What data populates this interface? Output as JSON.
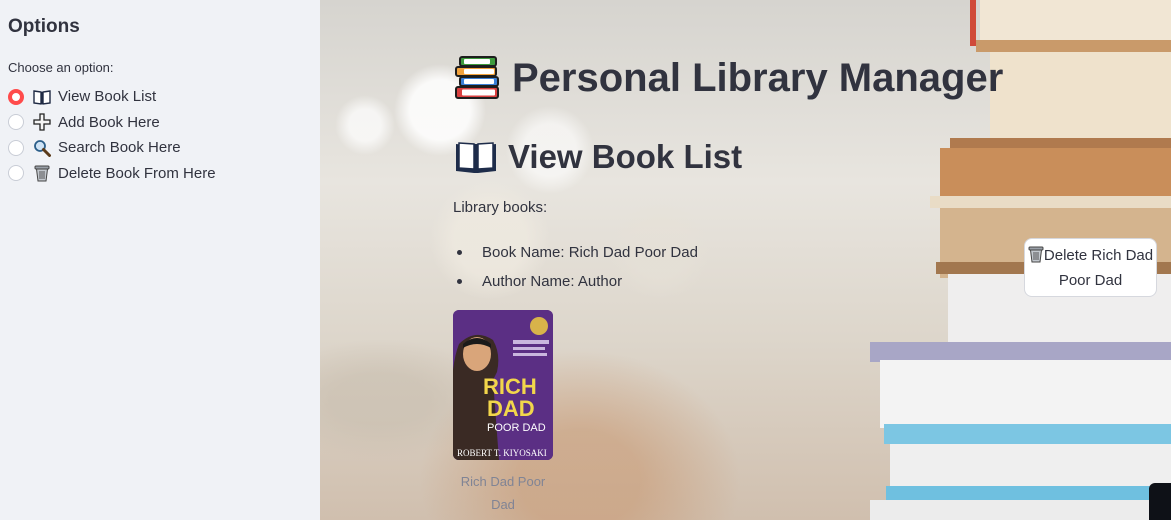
{
  "sidebar": {
    "title": "Options",
    "radio_label": "Choose an option:",
    "options": [
      {
        "label": "View Book List",
        "icon": "book-open-icon",
        "selected": true
      },
      {
        "label": "Add Book Here",
        "icon": "plus-icon",
        "selected": false
      },
      {
        "label": "Search Book Here",
        "icon": "magnifier-icon",
        "selected": false
      },
      {
        "label": "Delete Book From Here",
        "icon": "trash-icon",
        "selected": false
      }
    ]
  },
  "main": {
    "title": "Personal Library Manager",
    "title_icon": "stacked-books-icon",
    "section_title": "View Book List",
    "section_icon": "book-open-icon",
    "library_label": "Library books:",
    "book": {
      "name_line": "Book Name: Rich Dad Poor Dad",
      "author_line": "Author Name: Author",
      "cover_caption": "Rich Dad Poor Dad",
      "cover_title_lines": [
        "RICH",
        "DAD"
      ],
      "cover_subtitle": "POOR DAD",
      "cover_author": "ROBERT T. KIYOSAKI"
    },
    "delete_button": "Delete Rich Dad Poor Dad"
  },
  "colors": {
    "accent": "#ff4b4b",
    "sidebar_bg": "#f0f2f6",
    "text": "#31333f"
  }
}
